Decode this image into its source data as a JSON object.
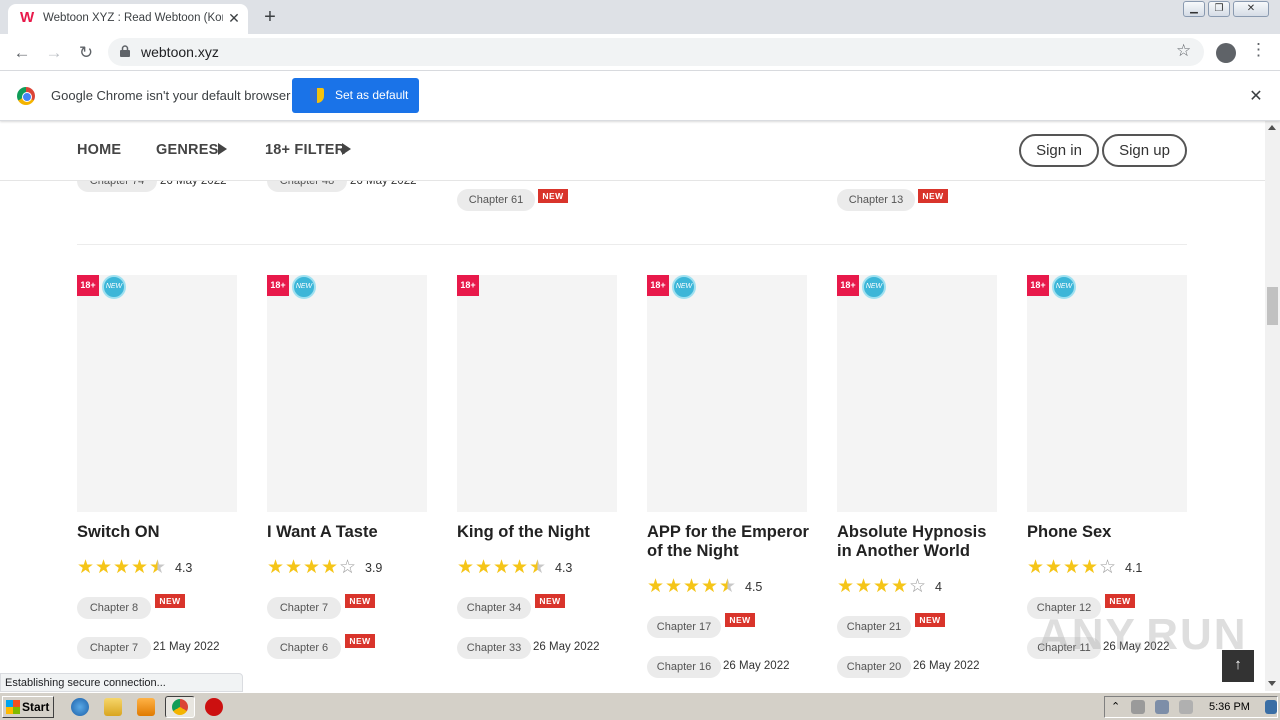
{
  "browser": {
    "tab_title": "Webtoon XYZ : Read Webtoon (Kore",
    "tab_favicon": "W",
    "url": "webtoon.xyz",
    "infobar_text": "Google Chrome isn't your default browser",
    "set_default_label": "Set as default"
  },
  "site": {
    "nav": {
      "home": "HOME",
      "genres": "GENRES",
      "filter": "18+ FILTER"
    },
    "sign_in": "Sign in",
    "sign_up": "Sign up"
  },
  "prev_row": [
    {
      "chapter": "Chapter 74",
      "date": "26 May 2022"
    },
    {
      "chapter": "Chapter 48",
      "date": "26 May 2022"
    },
    {
      "chapter": "Chapter 61",
      "badge": "NEW"
    },
    {
      "chapter": "Chapter 13",
      "badge": "NEW"
    }
  ],
  "badges": {
    "adult": "18+",
    "new_circle": "NEW",
    "new": "NEW"
  },
  "cards": [
    {
      "title": "Switch ON",
      "rating": "4.3",
      "chapter_latest": "Chapter 8",
      "chapter_prev": "Chapter 7",
      "prev_date": "21 May 2022",
      "prev_badge": ""
    },
    {
      "title": "I Want A Taste",
      "rating": "3.9",
      "chapter_latest": "Chapter 7",
      "chapter_prev": "Chapter 6",
      "prev_date": "",
      "prev_badge": "NEW"
    },
    {
      "title": "King of the Night",
      "rating": "4.3",
      "chapter_latest": "Chapter 34",
      "chapter_prev": "Chapter 33",
      "prev_date": "26 May 2022",
      "prev_badge": ""
    },
    {
      "title": "APP for the Emperor of the Night",
      "rating": "4.5",
      "chapter_latest": "Chapter 17",
      "chapter_prev": "Chapter 16",
      "prev_date": "26 May 2022",
      "prev_badge": ""
    },
    {
      "title": "Absolute Hypnosis in Another World",
      "rating": "4",
      "chapter_latest": "Chapter 21",
      "chapter_prev": "Chapter 20",
      "prev_date": "26 May 2022",
      "prev_badge": ""
    },
    {
      "title": "Phone Sex",
      "rating": "4.1",
      "chapter_latest": "Chapter 12",
      "chapter_prev": "Chapter 11",
      "prev_date": "26 May 2022",
      "prev_badge": ""
    }
  ],
  "status_text": "Establishing secure connection...",
  "watermark": "ANY.RUN",
  "taskbar": {
    "start": "Start",
    "clock": "5:36 PM"
  },
  "colors": {
    "accent": "#e8194a",
    "star": "#f5c518",
    "new_badge": "#d9342b",
    "new_circle": "#3db6d8"
  },
  "icons": [
    "w-logo-icon",
    "close-icon",
    "plus-icon",
    "back-icon",
    "forward-icon",
    "reload-icon",
    "lock-icon",
    "star-icon",
    "profile-icon",
    "menu-icon",
    "chrome-icon",
    "shield-icon",
    "arrow-up-icon"
  ]
}
